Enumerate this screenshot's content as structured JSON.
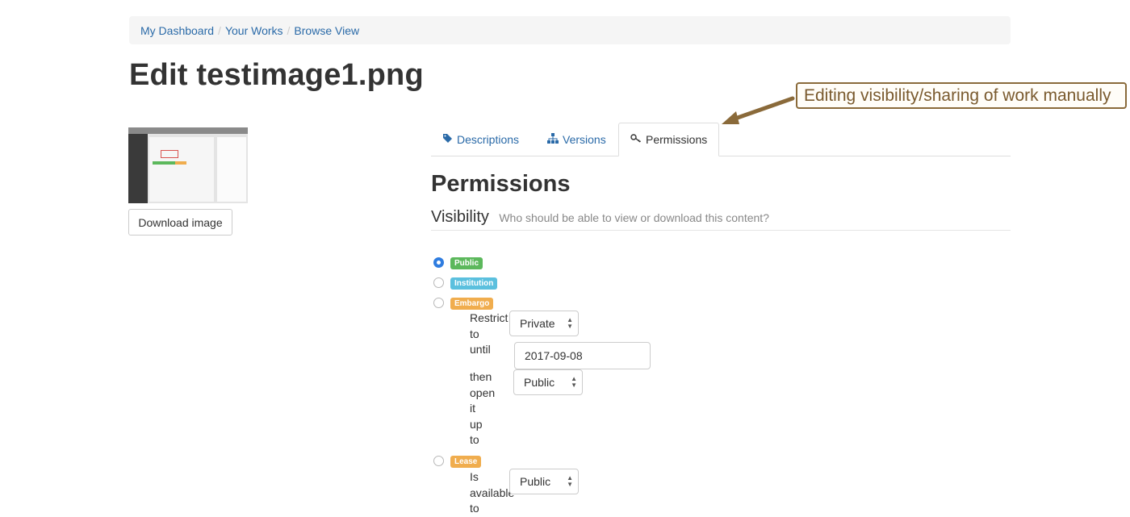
{
  "breadcrumb": {
    "items": [
      "My Dashboard",
      "Your Works",
      "Browse View"
    ],
    "separator": "/"
  },
  "page": {
    "title": "Edit testimage1.png"
  },
  "sidebar": {
    "download_label": "Download image"
  },
  "tabs": [
    {
      "label": "Descriptions",
      "icon": "tag-icon"
    },
    {
      "label": "Versions",
      "icon": "sitemap-icon"
    },
    {
      "label": "Permissions",
      "icon": "key-icon",
      "active": true
    }
  ],
  "permissions": {
    "title": "Permissions",
    "visibility_label": "Visibility",
    "visibility_hint": "Who should be able to view or download this content?",
    "options": [
      {
        "label": "Public",
        "color": "#5cb85c",
        "checked": true
      },
      {
        "label": "Institution",
        "color": "#5bc0de",
        "checked": false
      },
      {
        "label": "Embargo",
        "color": "#f0ad4e",
        "checked": false
      },
      {
        "label": "Lease",
        "color": "#f0ad4e",
        "checked": false
      }
    ],
    "embargo": {
      "restrict_text": "Restrict",
      "to_text": "to",
      "until_text": "until",
      "restrict_value": "Private",
      "date_value": "2017-09-08",
      "then_words": [
        "then",
        "open",
        "it",
        "up",
        "to"
      ],
      "release_value": "Public"
    },
    "lease": {
      "words": [
        "Is",
        "available",
        "to"
      ],
      "value": "Public"
    }
  },
  "annotation": {
    "text": "Editing visibility/sharing of work manually",
    "color": "#8a6a3a"
  }
}
